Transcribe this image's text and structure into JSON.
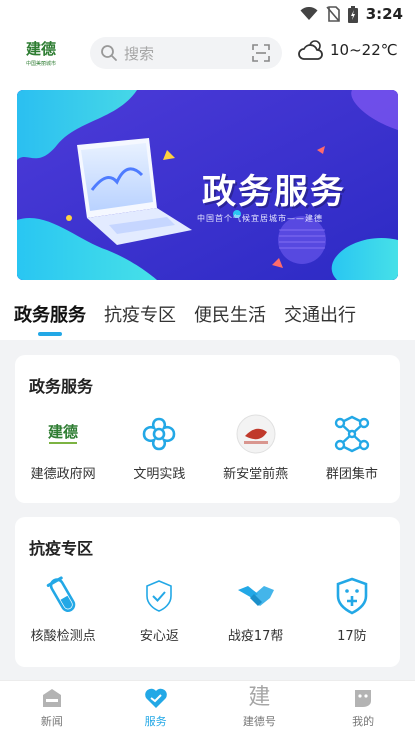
{
  "status_bar": {
    "time": "3:24"
  },
  "header": {
    "logo_text": "建德",
    "logo_sub": "中国美丽城市",
    "search_placeholder": "搜索",
    "weather": "10~22℃"
  },
  "banner": {
    "title": "政务服务",
    "subtitle": "中国首个气候宜居城市——建德"
  },
  "tabs": [
    {
      "label": "政务服务",
      "active": true
    },
    {
      "label": "抗疫专区",
      "active": false
    },
    {
      "label": "便民生活",
      "active": false
    },
    {
      "label": "交通出行",
      "active": false
    }
  ],
  "gov_section": {
    "title": "政务服务",
    "items": [
      {
        "label": "建德政府网",
        "icon": "jiande-logo-icon"
      },
      {
        "label": "文明实践",
        "icon": "flower-icon"
      },
      {
        "label": "新安堂前燕",
        "icon": "seal-icon"
      },
      {
        "label": "群团集市",
        "icon": "network-icon"
      }
    ]
  },
  "covid_section": {
    "title": "抗疫专区",
    "items": [
      {
        "label": "核酸检测点",
        "icon": "test-tube-icon"
      },
      {
        "label": "安心返",
        "icon": "shield-check-icon"
      },
      {
        "label": "战疫17帮",
        "icon": "handshake-icon"
      },
      {
        "label": "17防",
        "icon": "shield-plus-icon"
      }
    ]
  },
  "bottom_nav": [
    {
      "label": "新闻",
      "icon": "news-icon",
      "active": false
    },
    {
      "label": "服务",
      "icon": "heart-icon",
      "active": true
    },
    {
      "label": "建德号",
      "icon": "jian-icon",
      "glyph": "建",
      "active": false
    },
    {
      "label": "我的",
      "icon": "profile-icon",
      "active": false
    }
  ],
  "colors": {
    "accent": "#23a8e6",
    "banner_bg": "#3a2fd4"
  }
}
